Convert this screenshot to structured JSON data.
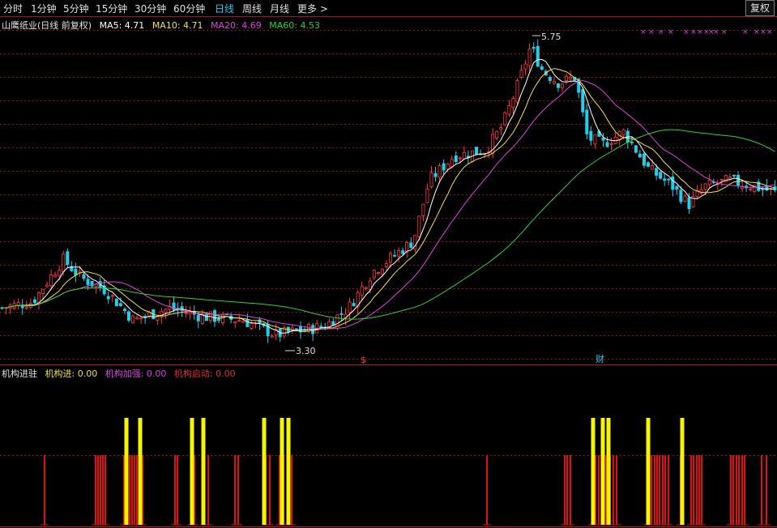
{
  "period_tabs": [
    {
      "label": "分时",
      "active": false
    },
    {
      "label": "1分钟",
      "active": false
    },
    {
      "label": "5分钟",
      "active": false
    },
    {
      "label": "15分钟",
      "active": false
    },
    {
      "label": "30分钟",
      "active": false
    },
    {
      "label": "60分钟",
      "active": false
    },
    {
      "label": "日线",
      "active": true
    },
    {
      "label": "周线",
      "active": false
    },
    {
      "label": "月线",
      "active": false
    },
    {
      "label": "更多 >",
      "active": false
    }
  ],
  "fuquan_button": "复权",
  "main_legend": {
    "title": "山鹰纸业(日线 前复权)",
    "ma5": "MA5: 4.71",
    "ma10": "MA10: 4.71",
    "ma20": "MA20: 4.69",
    "ma60": "MA60: 4.53"
  },
  "sub_legend": {
    "title": "机构进驻",
    "a": "机构进: 0.00",
    "b": "机构加强: 0.00",
    "c": "机构启动: 0.00"
  },
  "colors": {
    "up": "#ff3b3b",
    "down": "#20d0e8",
    "ma5": "#ffffff",
    "ma10": "#f0e040",
    "ma20": "#e040e0",
    "ma60": "#30d030",
    "grid": "#8a1515",
    "bar_red": "#e01010",
    "bar_yellow": "#f5f500"
  },
  "annotations": {
    "high_label": "5.75",
    "low_label": "3.30",
    "event_marker_1": "$",
    "event_marker_2": "财"
  },
  "chart_data": {
    "type": "candlestick",
    "price_high": 5.75,
    "price_low": 3.3,
    "ma_last": {
      "ma5": 4.71,
      "ma10": 4.71,
      "ma20": 4.69,
      "ma60": 4.53
    }
  }
}
